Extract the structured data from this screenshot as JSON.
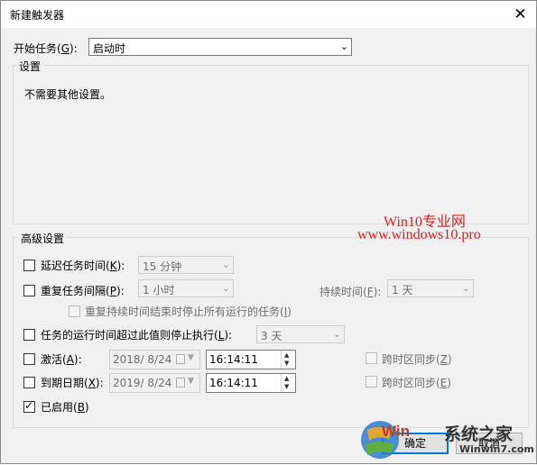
{
  "window": {
    "title": "新建触发器",
    "close_glyph": "✕"
  },
  "begin_task": {
    "label_prefix": "开始任务(",
    "label_key": "G",
    "label_suffix": "):",
    "value": "启动时"
  },
  "settings": {
    "legend": "设置",
    "message": "不需要其他设置。"
  },
  "watermark": {
    "line1": "Win10专业网",
    "line2": "www.windows10.pro",
    "logo_text": "系统之家",
    "logo_url": "Winwin7.com",
    "logo_letters": "Win"
  },
  "advanced": {
    "legend": "高级设置",
    "delay": {
      "label_prefix": "延迟任务时间(",
      "key": "K",
      "label_suffix": "):",
      "value": "15 分钟",
      "checked": false
    },
    "repeat": {
      "label_prefix": "重复任务间隔(",
      "key": "P",
      "label_suffix": "):",
      "value": "1 小时",
      "checked": false,
      "duration_prefix": "持续时间(",
      "duration_key": "F",
      "duration_suffix": "):",
      "duration_value": "1 天"
    },
    "stop_repeat": {
      "label_prefix": "重复持续时间结束时停止所有运行的任务(",
      "key": "I",
      "label_suffix": ")",
      "checked": false
    },
    "stop_long": {
      "label_prefix": "任务的运行时间超过此值则停止执行(",
      "key": "L",
      "label_suffix": "):",
      "value": "3 天",
      "checked": false
    },
    "activate": {
      "label_prefix": "激活(",
      "key": "A",
      "label_suffix": "):",
      "date": "2018/  8/24",
      "time": "16:14:11",
      "checked": false,
      "sync_prefix": "跨时区同步(",
      "sync_key": "Z",
      "sync_suffix": ")"
    },
    "expire": {
      "label_prefix": "到期日期(",
      "key": "X",
      "label_suffix": "):",
      "date": "2019/  8/24",
      "time": "16:14:11",
      "checked": false,
      "sync_prefix": "跨时区同步(",
      "sync_key": "E",
      "sync_suffix": ")"
    },
    "enabled": {
      "label_prefix": "已启用(",
      "key": "B",
      "label_suffix": ")",
      "checked": true
    }
  },
  "buttons": {
    "ok_prefix": "确",
    "ok_rest": "定",
    "cancel": "取消"
  },
  "colors": {
    "watermark_red": "#e21c1c",
    "focus_blue": "#0078d7"
  }
}
